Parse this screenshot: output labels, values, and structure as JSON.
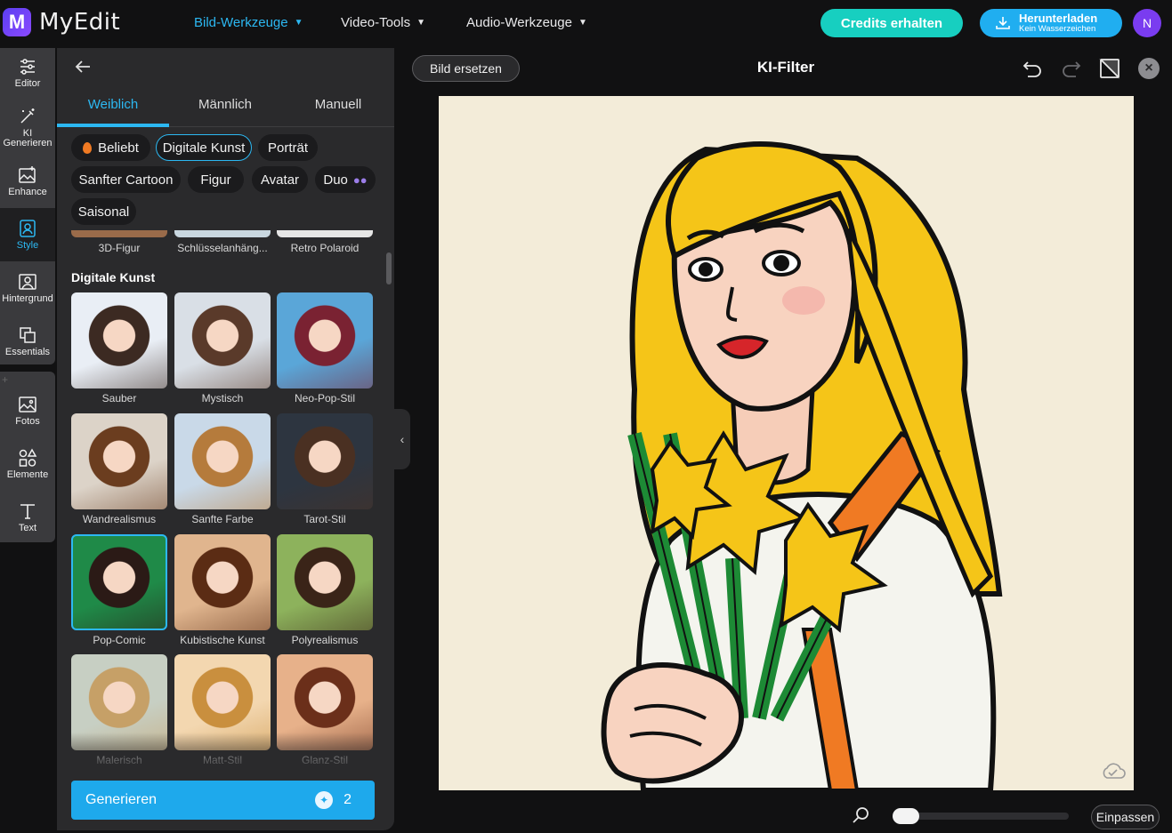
{
  "app": {
    "name": "MyEdit",
    "logo_letter": "M"
  },
  "nav": [
    {
      "label": "Bild-Werkzeuge",
      "active": true
    },
    {
      "label": "Video-Tools",
      "active": false
    },
    {
      "label": "Audio-Werkzeuge",
      "active": false
    }
  ],
  "header": {
    "credits_label": "Credits erhalten",
    "download_label": "Herunterladen",
    "download_sub": "Kein Wasserzeichen",
    "avatar_initial": "N"
  },
  "rail": [
    {
      "label": "Editor",
      "icon": "sliders-icon"
    },
    {
      "label": "KI Generieren",
      "icon": "magic-wand-icon"
    },
    {
      "label": "Enhance",
      "icon": "image-sparkle-icon"
    },
    {
      "label": "Style",
      "icon": "style-portrait-icon",
      "active": true
    },
    {
      "label": "Hintergrund",
      "icon": "background-icon"
    },
    {
      "label": "Essentials",
      "icon": "layers-icon"
    },
    {
      "label": "Fotos",
      "icon": "photo-icon"
    },
    {
      "label": "Elemente",
      "icon": "shapes-icon"
    },
    {
      "label": "Text",
      "icon": "text-icon"
    }
  ],
  "panel": {
    "tabs": [
      "Weiblich",
      "Männlich",
      "Manuell"
    ],
    "active_tab": "Weiblich",
    "chips": [
      "Beliebt",
      "Digitale Kunst",
      "Porträt",
      "Sanfter Cartoon",
      "Figur",
      "Avatar",
      "Duo",
      "Saisonal"
    ],
    "selected_chip": "Digitale Kunst",
    "prev_row_labels": [
      "3D-Figur",
      "Schlüsselanhäng...",
      "Retro Polaroid"
    ],
    "section_title": "Digitale Kunst",
    "styles": [
      "Sauber",
      "Mystisch",
      "Neo-Pop-Stil",
      "Wandrealismus",
      "Sanfte Farbe",
      "Tarot-Stil",
      "Pop-Comic",
      "Kubistische Kunst",
      "Polyrealismus",
      "Malerisch",
      "Matt-Stil",
      "Glanz-Stil"
    ],
    "selected_style": "Pop-Comic",
    "generate_label": "Generieren",
    "generate_cost": "2"
  },
  "canvas": {
    "replace_label": "Bild ersetzen",
    "title": "KI-Filter",
    "fit_label": "Einpassen",
    "zoom_level": 0
  },
  "colors": {
    "accent": "#2cb8f2",
    "credits": "#17cfc0",
    "download": "#20aef0",
    "avatar": "#7a3cf0",
    "panel_bg": "#2a2a2c",
    "canvas_bg": "#f3ecd9"
  }
}
